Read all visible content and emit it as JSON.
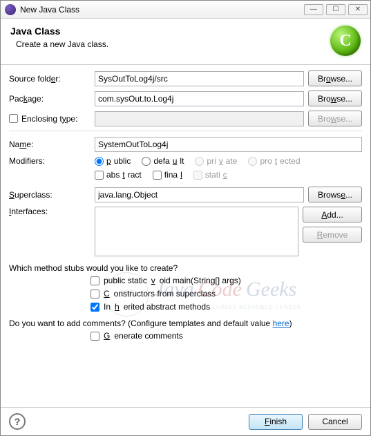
{
  "window": {
    "title": "New Java Class"
  },
  "banner": {
    "heading": "Java Class",
    "sub": "Create a new Java class.",
    "icon_letter": "C"
  },
  "labels": {
    "source_folder": "Source folder:",
    "package": "Package:",
    "enclosing": "Enclosing type:",
    "name": "Name:",
    "modifiers": "Modifiers:",
    "superclass": "Superclass:",
    "interfaces": "Interfaces:"
  },
  "fields": {
    "source_folder": "SysOutToLog4j/src",
    "package": "com.sysOut.to.Log4j",
    "enclosing": "",
    "name": "SystemOutToLog4j",
    "superclass": "java.lang.Object"
  },
  "underlines": {
    "source_folder_u": "o",
    "package_u": "k",
    "name_u": "m",
    "modifiers_mod": "M",
    "superclass_u": "S",
    "interfaces_u": "I"
  },
  "modifiers": {
    "public": "public",
    "default": "default",
    "private": "private",
    "protected": "protected",
    "abstract": "abstract",
    "final": "final",
    "static": "static"
  },
  "methodstubs": {
    "question": "Which method stubs would you like to create?",
    "main": "public static void main(String[] args)",
    "constructors": "Constructors from superclass",
    "inherited": "Inherited abstract methods"
  },
  "comments": {
    "question_pre": "Do you want to add comments? (Configure templates and default value ",
    "link": "here",
    "question_post": ")",
    "generate": "Generate comments"
  },
  "buttons": {
    "browse": "Browse...",
    "add": "Add...",
    "remove": "Remove",
    "finish": "Finish",
    "cancel": "Cancel"
  },
  "watermark": {
    "main": "Java Code Geeks",
    "sub": "Java 2 Java Developers Resource Center"
  }
}
